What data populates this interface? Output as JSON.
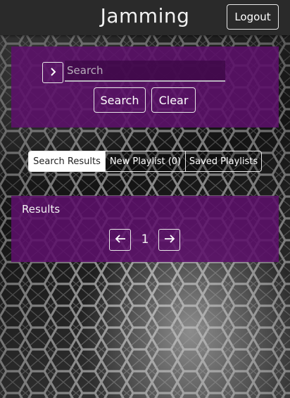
{
  "header": {
    "title": "Jamming",
    "logout_label": "Logout"
  },
  "search": {
    "placeholder": "Search",
    "value": "",
    "search_label": "Search",
    "clear_label": "Clear"
  },
  "tabs": [
    {
      "label": "Search Results",
      "active": true
    },
    {
      "label": "New Playlist (0)",
      "active": false
    },
    {
      "label": "Saved Playlists",
      "active": false
    }
  ],
  "results": {
    "title": "Results",
    "page": "1"
  },
  "icons": {
    "expand": "chevron-right-icon",
    "prev": "arrow-left-icon",
    "next": "arrow-right-icon"
  },
  "colors": {
    "header_bg": "#2a2a2a",
    "panel_bg": "#5c106a",
    "border": "#e8e8e8",
    "active_tab_bg": "#ffffff",
    "active_tab_text": "#222222"
  }
}
